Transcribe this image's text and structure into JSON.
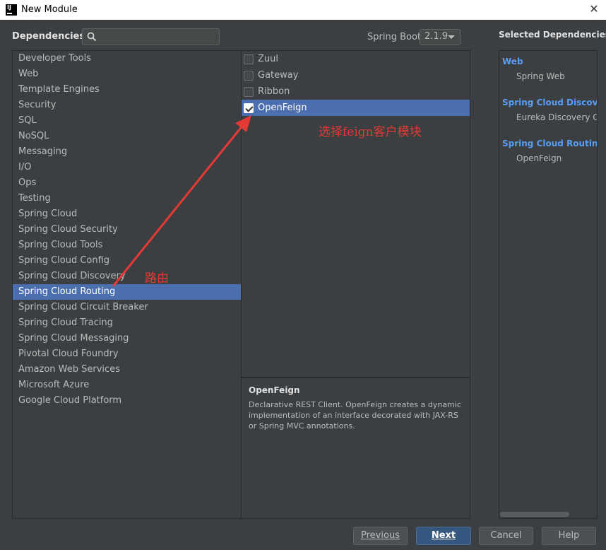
{
  "window": {
    "title": "New Module",
    "icon_label": "IJ"
  },
  "header": {
    "dependencies_label": "Dependencies",
    "search_placeholder": "",
    "spring_boot_label": "Spring Boot",
    "spring_boot_version": "2.1.9"
  },
  "categories": [
    "Developer Tools",
    "Web",
    "Template Engines",
    "Security",
    "SQL",
    "NoSQL",
    "Messaging",
    "I/O",
    "Ops",
    "Testing",
    "Spring Cloud",
    "Spring Cloud Security",
    "Spring Cloud Tools",
    "Spring Cloud Config",
    "Spring Cloud Discovery",
    "Spring Cloud Routing",
    "Spring Cloud Circuit Breaker",
    "Spring Cloud Tracing",
    "Spring Cloud Messaging",
    "Pivotal Cloud Foundry",
    "Amazon Web Services",
    "Microsoft Azure",
    "Google Cloud Platform"
  ],
  "selected_category": "Spring Cloud Routing",
  "dependencies": [
    {
      "label": "Zuul",
      "checked": false
    },
    {
      "label": "Gateway",
      "checked": false
    },
    {
      "label": "Ribbon",
      "checked": false
    },
    {
      "label": "OpenFeign",
      "checked": true
    }
  ],
  "description": {
    "title": "OpenFeign",
    "text": "Declarative REST Client. OpenFeign creates a dynamic implementation of an interface decorated with JAX-RS or Spring MVC annotations."
  },
  "selected_panel": {
    "title": "Selected Dependencies",
    "groups": [
      {
        "name": "Web",
        "items": [
          "Spring Web"
        ]
      },
      {
        "name": "Spring Cloud Discover",
        "items": [
          "Eureka Discovery Cl"
        ]
      },
      {
        "name": "Spring Cloud Routing",
        "items": [
          "OpenFeign"
        ]
      }
    ]
  },
  "buttons": {
    "previous": "Previous",
    "next": "Next",
    "cancel": "Cancel",
    "help": "Help"
  },
  "annotations": {
    "feign_note": "选择feign客户模块",
    "routing_note": "路由"
  },
  "colors": {
    "selection": "#4b6eaf",
    "group_title": "#589df6",
    "annotation": "#e53935",
    "primary_button": "#365880"
  }
}
